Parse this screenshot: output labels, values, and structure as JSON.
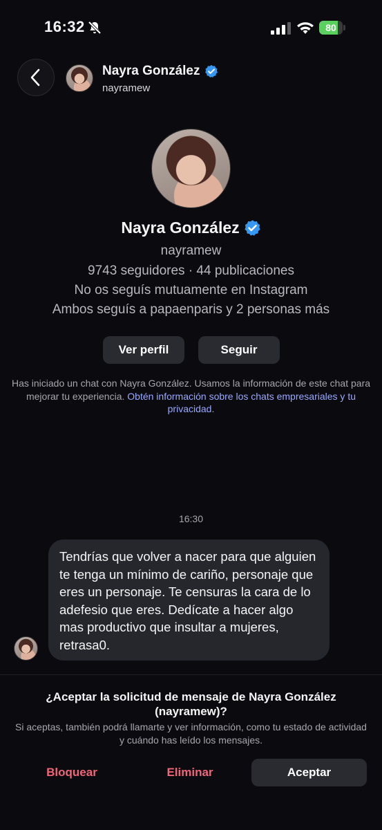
{
  "status_bar": {
    "time": "16:32",
    "battery": "80",
    "battery_level": 0.8,
    "icons": [
      "bell-slash-icon",
      "signal-icon",
      "wifi-icon",
      "battery-charging-icon"
    ]
  },
  "header": {
    "name": "Nayra González",
    "username": "nayramew",
    "verified": true
  },
  "profile": {
    "name": "Nayra González",
    "username": "nayramew",
    "stats": "9743 seguidores · 44 publicaciones",
    "mutual": "No os seguís mutuamente en Instagram",
    "common": "Ambos seguís a papaenparis y 2 personas más",
    "view_profile_label": "Ver perfil",
    "follow_label": "Seguir"
  },
  "info": {
    "text": "Has iniciado un chat con Nayra González. Usamos la información de este chat para mejorar tu experiencia. ",
    "link": "Obtén información sobre los chats empresariales y tu privacidad",
    "end": "."
  },
  "chat": {
    "timestamp": "16:30",
    "message": "Tendrías que volver a nacer para que alguien te tenga un mínimo de cariño, personaje que eres un personaje. Te censuras la cara de lo adefesio que eres. Dedícate a hacer algo mas productivo que insultar a mujeres, retrasa0."
  },
  "request": {
    "title": "¿Aceptar la solicitud de mensaje de Nayra González (nayramew)?",
    "subtitle": "Si aceptas, también podrá llamarte y ver información, como tu estado de actividad y cuándo has leído los mensajes.",
    "block_label": "Bloquear",
    "delete_label": "Eliminar",
    "accept_label": "Aceptar"
  },
  "colors": {
    "background": "#0b0b0f",
    "danger": "#f0657a",
    "link": "#9aa8ff",
    "verified": "#3897f0",
    "battery": "#5ad05e"
  }
}
